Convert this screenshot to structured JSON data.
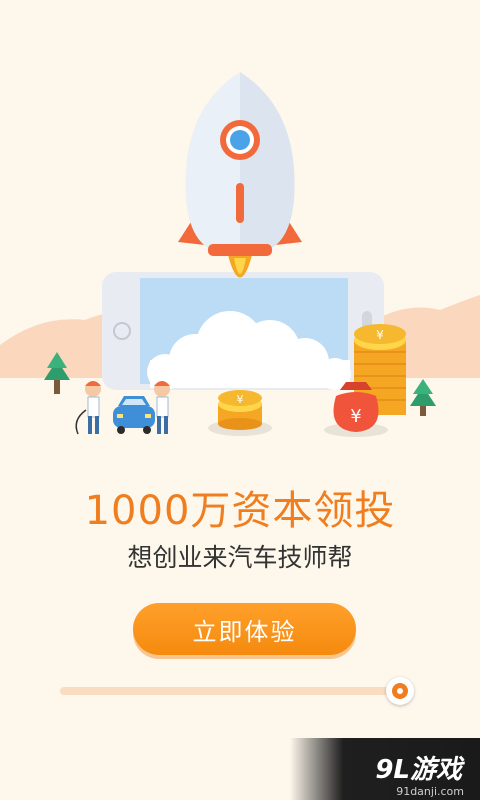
{
  "headline": "1000万资本领投",
  "subline": "想创业来汽车技师帮",
  "cta_label": "立即体验",
  "progress": {
    "value": 1.0
  },
  "illustration": {
    "coin_symbol": "¥",
    "bag_symbol": "¥"
  },
  "watermark": {
    "brand": "9L游戏",
    "url": "91danji.com"
  },
  "colors": {
    "accent": "#f07d1e",
    "background": "#fdf7ec",
    "button": "#f7931a"
  }
}
